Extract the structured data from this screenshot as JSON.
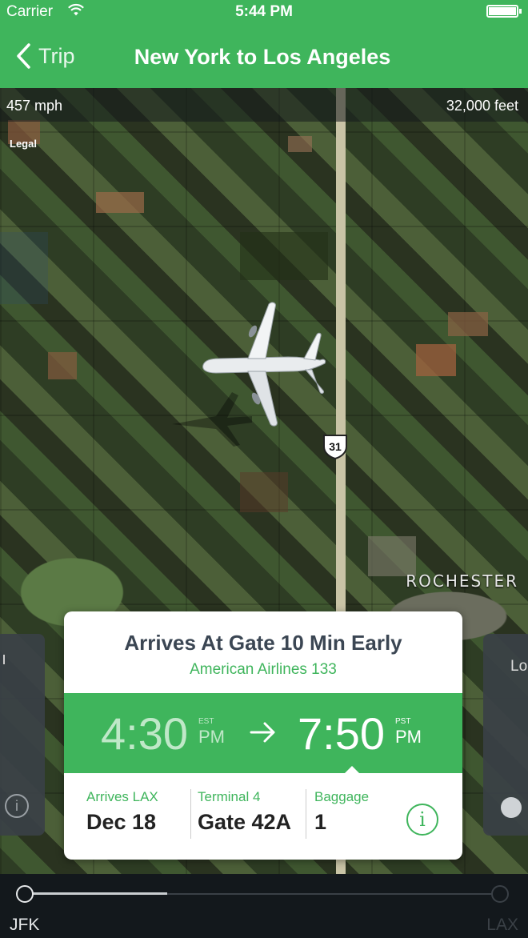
{
  "status_bar": {
    "carrier": "Carrier",
    "time": "5:44 PM"
  },
  "nav": {
    "back_label": "Trip",
    "title": "New York to Los Angeles"
  },
  "map": {
    "speed": "457 mph",
    "altitude": "32,000 feet",
    "legal": "Legal",
    "route_shield": "31",
    "city": "ROCHESTER"
  },
  "side_cards": {
    "right_label": "Lo"
  },
  "flight_card": {
    "headline": "Arrives At Gate 10 Min Early",
    "airline": "American Airlines 133",
    "departure": {
      "time": "4:30",
      "tz": "EST",
      "ampm": "PM"
    },
    "arrival": {
      "time": "7:50",
      "tz": "PST",
      "ampm": "PM"
    },
    "details": [
      {
        "label": "Arrives LAX",
        "value": "Dec 18"
      },
      {
        "label": "Terminal 4",
        "value": "Gate 42A"
      },
      {
        "label": "Baggage",
        "value": "1"
      }
    ],
    "info_glyph": "i"
  },
  "timeline": {
    "from": "JFK",
    "to": "LAX",
    "progress": 0.3
  },
  "colors": {
    "accent": "#3fb55c",
    "dark_text": "#3b4653"
  }
}
